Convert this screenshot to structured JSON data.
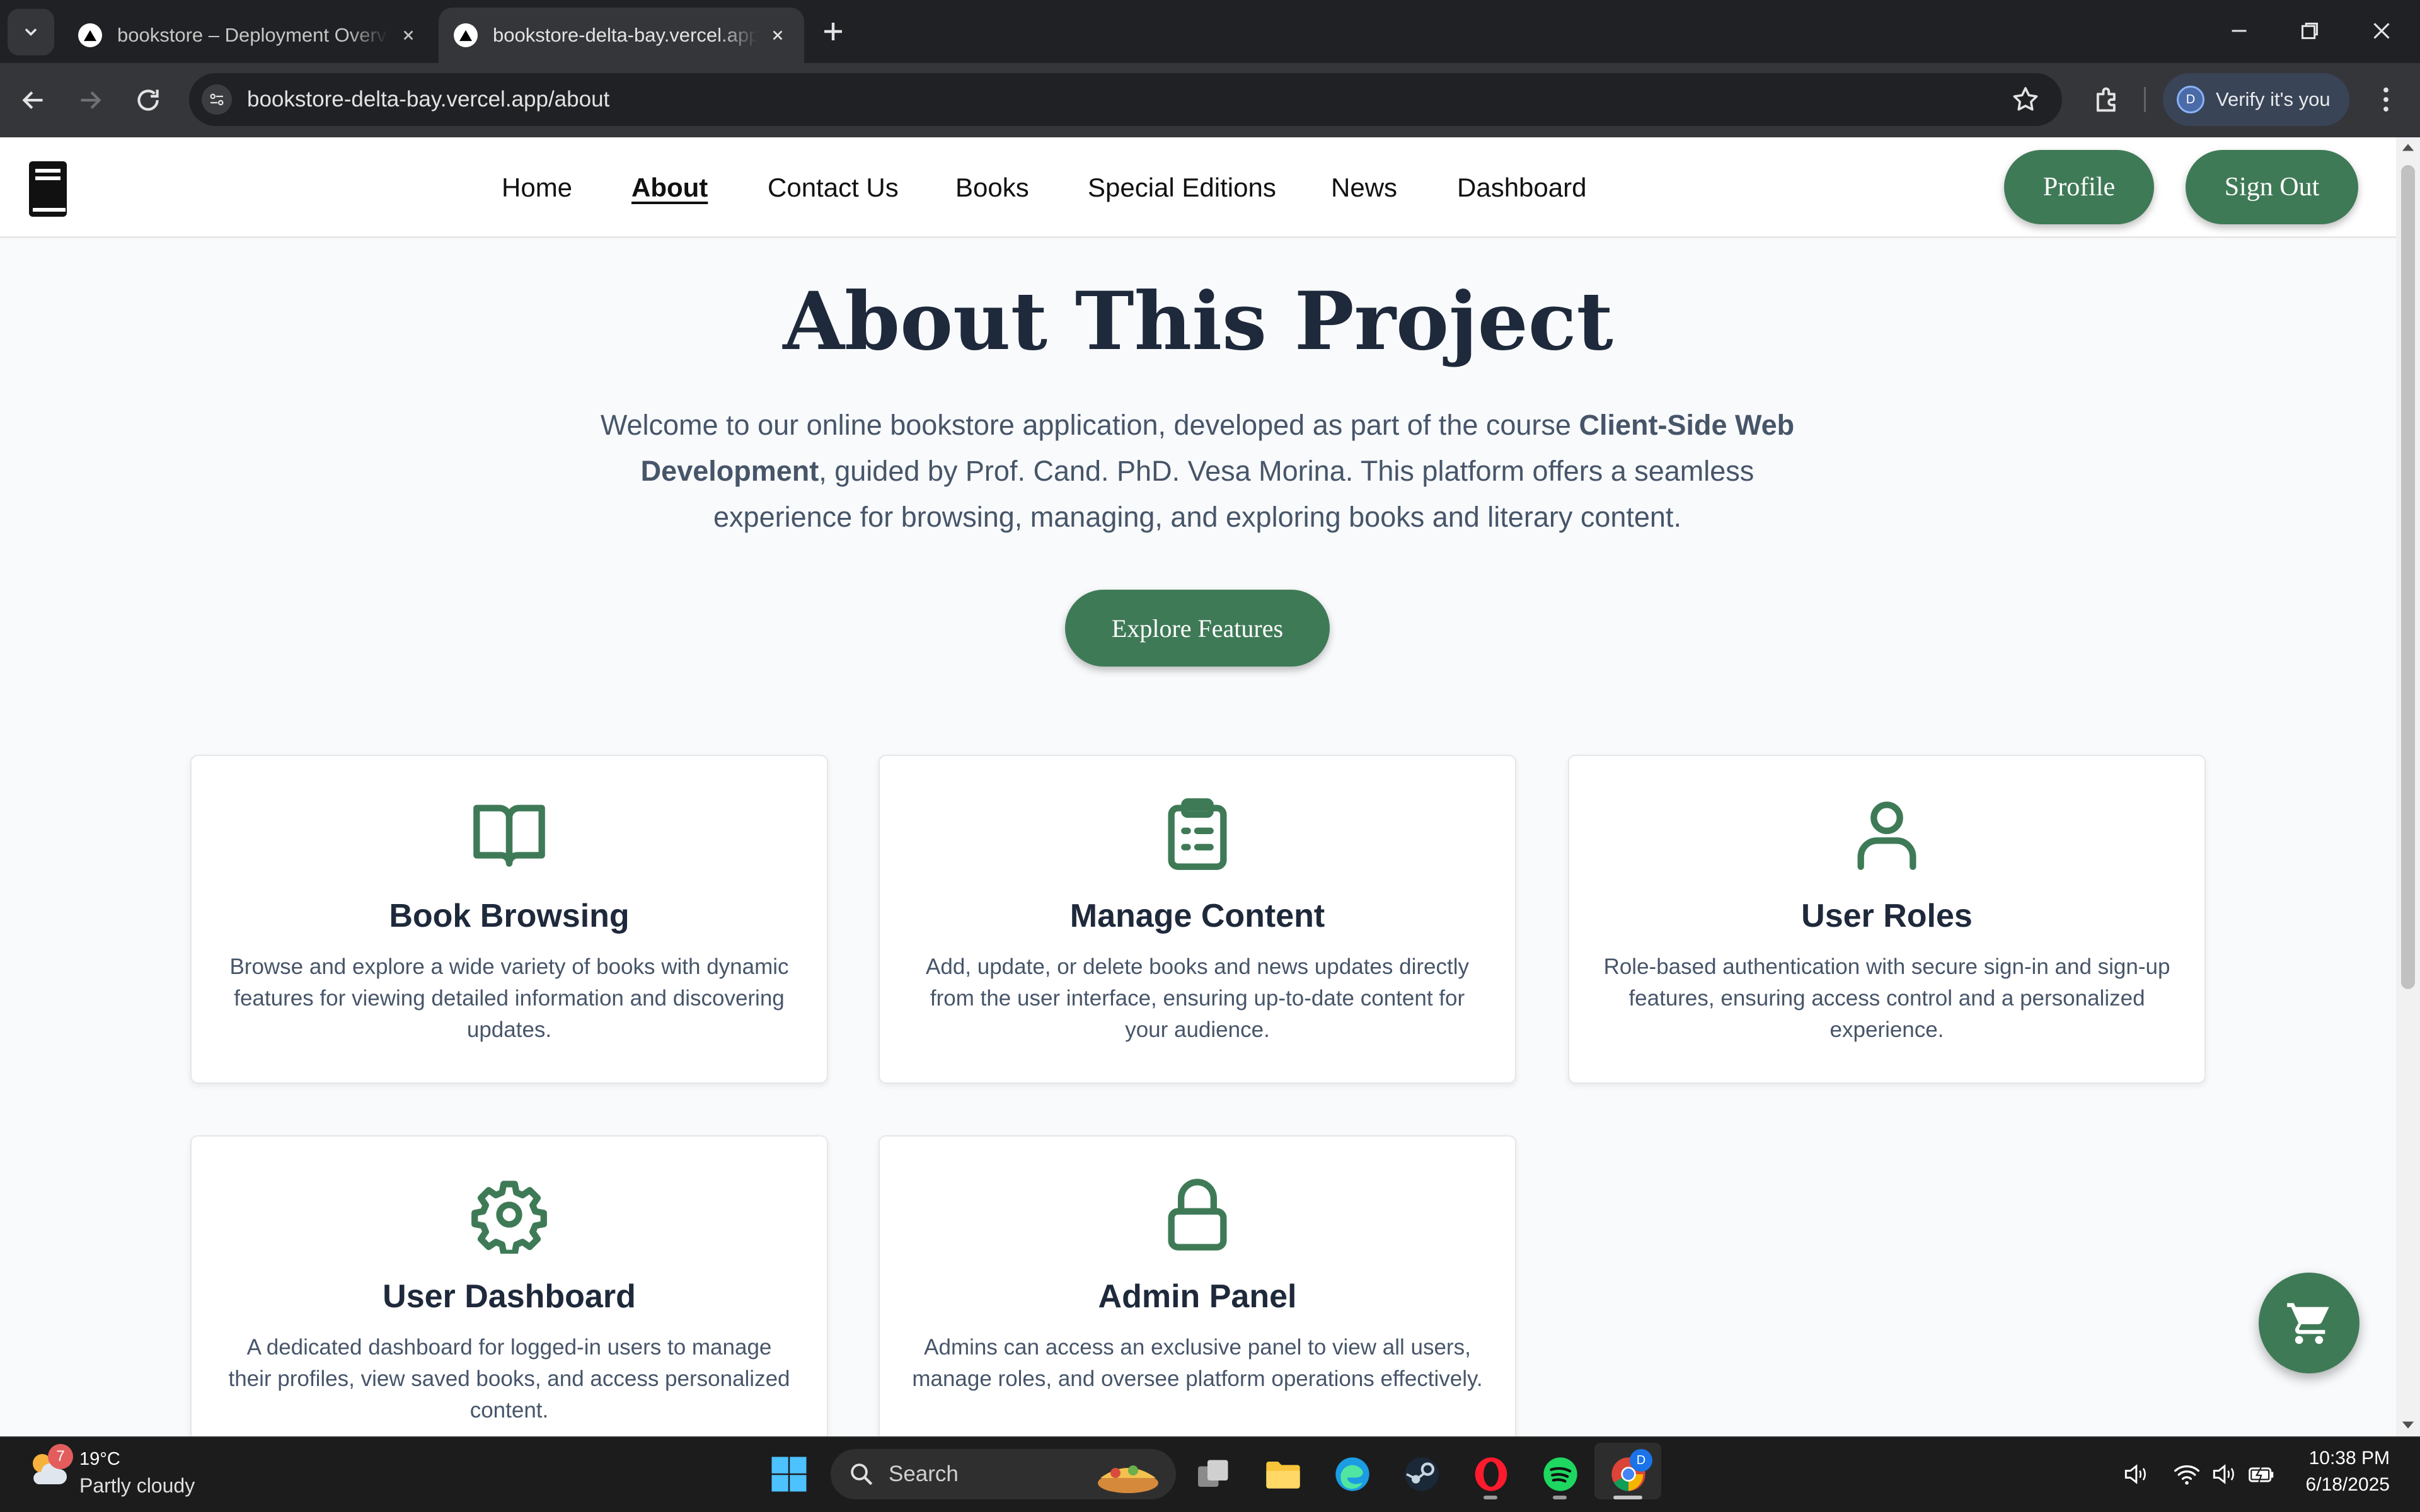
{
  "browser": {
    "tabs": [
      {
        "title": "bookstore – Deployment Overview – Vercel",
        "active": false
      },
      {
        "title": "bookstore-delta-bay.vercel.app/about",
        "active": true
      }
    ],
    "url": "bookstore-delta-bay.vercel.app/about",
    "verify_label": "Verify it's you",
    "avatar_letter": "D"
  },
  "site": {
    "nav": [
      "Home",
      "About",
      "Contact Us",
      "Books",
      "Special Editions",
      "News",
      "Dashboard"
    ],
    "current_nav": "About",
    "profile_button": "Profile",
    "signout_button": "Sign Out",
    "heading": "About This Project",
    "intro": {
      "part1": "Welcome to our online bookstore application, developed as part of the course ",
      "course": "Client-Side Web Development",
      "part2": ", guided by Prof. Cand. PhD. Vesa Morina. This platform offers a seamless experience for browsing, managing, and exploring books and literary content."
    },
    "cta_button": "Explore Features",
    "accent_color": "#3f7a57",
    "features": [
      {
        "icon": "book-open-icon",
        "title": "Book Browsing",
        "description": "Browse and explore a wide variety of books with dynamic features for viewing detailed information and discovering updates."
      },
      {
        "icon": "clipboard-list-icon",
        "title": "Manage Content",
        "description": "Add, update, or delete books and news updates directly from the user interface, ensuring up-to-date content for your audience."
      },
      {
        "icon": "user-icon",
        "title": "User Roles",
        "description": "Role-based authentication with secure sign-in and sign-up features, ensuring access control and a personalized experience."
      },
      {
        "icon": "gear-icon",
        "title": "User Dashboard",
        "description": "A dedicated dashboard for logged-in users to manage their profiles, view saved books, and access personalized content."
      },
      {
        "icon": "lock-icon",
        "title": "Admin Panel",
        "description": "Admins can access an exclusive panel to view all users, manage roles, and oversee platform operations effectively."
      }
    ]
  },
  "taskbar": {
    "weather_temp": "19°C",
    "weather_desc": "Partly cloudy",
    "weather_badge": "7",
    "search_label": "Search",
    "time": "10:38 PM",
    "date": "6/18/2025",
    "chrome_badge": "D"
  }
}
